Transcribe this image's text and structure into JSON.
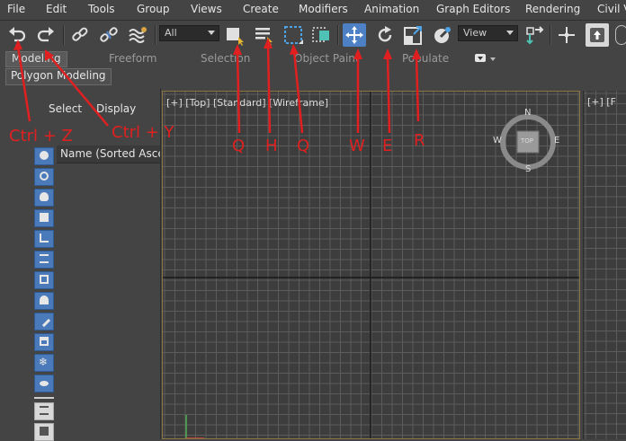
{
  "menu": [
    "File",
    "Edit",
    "Tools",
    "Group",
    "Views",
    "Create",
    "Modifiers",
    "Animation",
    "Graph Editors",
    "Rendering",
    "Civil V"
  ],
  "toolbar": {
    "selection_filter": "All",
    "reference_coord": "View",
    "buttons": [
      "undo-icon",
      "redo-icon",
      "link-icon",
      "unlink-icon",
      "bind-space-warp-icon",
      "select-object-icon",
      "select-by-name-icon",
      "rectangular-selection-icon",
      "window-crossing-icon",
      "select-move-icon",
      "select-rotate-icon",
      "select-scale-icon",
      "pivot-icon",
      "manipulate-icon",
      "keyboard-shortcut-icon"
    ]
  },
  "ribbon": {
    "tabs": [
      "Modeling",
      "Freeform",
      "Selection",
      "Object Paint",
      "Populate"
    ],
    "active_tab": "Modeling",
    "sub_button": "Polygon Modeling"
  },
  "scene_explorer": {
    "tabs": [
      "Select",
      "Display"
    ],
    "column_header": "Name (Sorted Asce"
  },
  "viewport": {
    "label": "[+] [Top] [Standard] [Wireframe]",
    "second_label": "[+] [F",
    "viewcube": {
      "face": "TOP",
      "north": "N",
      "south": "S",
      "east": "E",
      "west": "W"
    },
    "grid_color": "#5c5c5c",
    "axis_color": "#1a1a1a"
  },
  "annotations": [
    "Ctrl + Z",
    "Ctrl + Y",
    "Q",
    "H",
    "Q",
    "W",
    "E",
    "R"
  ],
  "colors": {
    "accent": "#4d80c4",
    "annotation": "#e02020",
    "viewport_border": "#8a7440"
  }
}
